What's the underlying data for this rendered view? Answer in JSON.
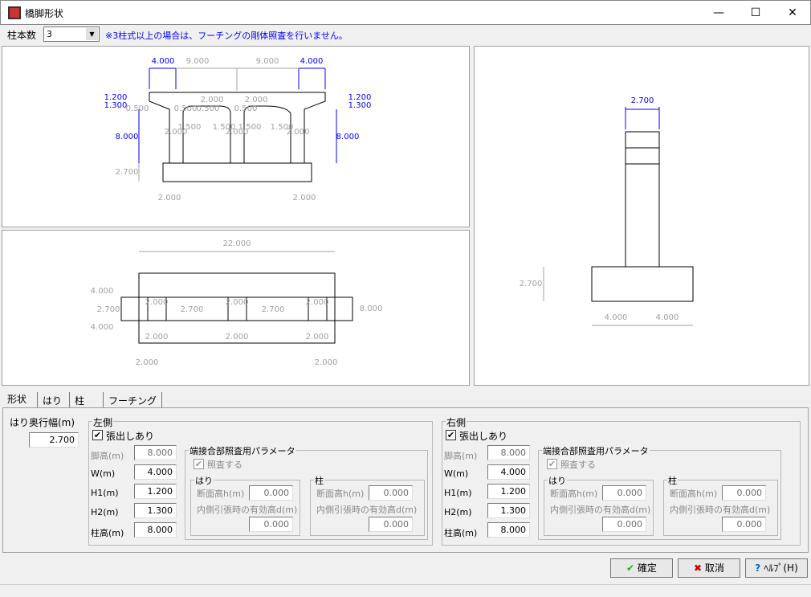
{
  "window": {
    "title": "橋脚形状",
    "minimize": "—",
    "maximize": "☐",
    "close": "✕"
  },
  "toolbar": {
    "column_count_label": "柱本数",
    "column_count_value": "3",
    "note": "※3柱式以上の場合は、フーチングの剛体照査を行いません。"
  },
  "colors": {
    "accent_dim": "#0000ff",
    "gray_dim": "#a0a0a0",
    "note": "#0000ff"
  },
  "front_view": {
    "blue_labels": [
      "4.000",
      "4.000",
      "1.200",
      "1.300",
      "1.200",
      "1.300",
      "8.000",
      "8.000"
    ],
    "gray_labels": [
      "9.000",
      "9.000",
      "2.000",
      "2.000",
      "0.500",
      "0.500",
      "0.500",
      "0.500",
      "1.500",
      "1.500",
      "1.500",
      "1.500",
      "2.000",
      "2.000",
      "2.000",
      "2.700",
      "2.000",
      "2.000"
    ]
  },
  "plan_view": {
    "labels": [
      "22.000",
      "4.000",
      "2.700",
      "4.000",
      "8.000",
      "2.000",
      "2.700",
      "2.000",
      "2.700",
      "2.000",
      "2.000",
      "2.000",
      "2.000",
      "2.000",
      "2.000"
    ]
  },
  "side_view": {
    "labels": [
      "2.700",
      "2.700",
      "4.000",
      "4.000"
    ]
  },
  "tabs": [
    {
      "label": "形状"
    },
    {
      "label": "はり"
    },
    {
      "label": "柱"
    },
    {
      "label": "フーチング"
    }
  ],
  "form": {
    "beam_depth_label": "はり奥行幅(m)",
    "beam_depth_value": "2.700",
    "left": {
      "title": "左側",
      "overhang_label": "張出しあり",
      "overhang_checked": true,
      "pier_height_label": "脚高(m)",
      "pier_height": "8.000",
      "w_label": "W(m)",
      "w": "4.000",
      "h1_label": "H1(m)",
      "h1": "1.200",
      "h2_label": "H2(m)",
      "h2": "1.300",
      "col_height_label": "柱高(m)",
      "col_height": "8.000",
      "param_title": "端接合部照査用パラメータ",
      "check_label": "照査する",
      "beam": {
        "title": "はり",
        "h_label": "断面高h(m)",
        "h": "0.000",
        "d_label": "内側引張時の有効高d(m)",
        "d": "0.000"
      },
      "column": {
        "title": "柱",
        "h_label": "断面高h(m)",
        "h": "0.000",
        "d_label": "内側引張時の有効高d(m)",
        "d": "0.000"
      }
    },
    "right": {
      "title": "右側",
      "overhang_label": "張出しあり",
      "overhang_checked": true,
      "pier_height_label": "脚高(m)",
      "pier_height": "8.000",
      "w_label": "W(m)",
      "w": "4.000",
      "h1_label": "H1(m)",
      "h1": "1.200",
      "h2_label": "H2(m)",
      "h2": "1.300",
      "col_height_label": "柱高(m)",
      "col_height": "8.000",
      "param_title": "端接合部照査用パラメータ",
      "check_label": "照査する",
      "beam": {
        "title": "はり",
        "h_label": "断面高h(m)",
        "h": "0.000",
        "d_label": "内側引張時の有効高d(m)",
        "d": "0.000"
      },
      "column": {
        "title": "柱",
        "h_label": "断面高h(m)",
        "h": "0.000",
        "d_label": "内側引張時の有効高d(m)",
        "d": "0.000"
      }
    }
  },
  "buttons": {
    "ok": "確定",
    "cancel": "取消",
    "help": "ﾍﾙﾌﾟ(H)"
  }
}
